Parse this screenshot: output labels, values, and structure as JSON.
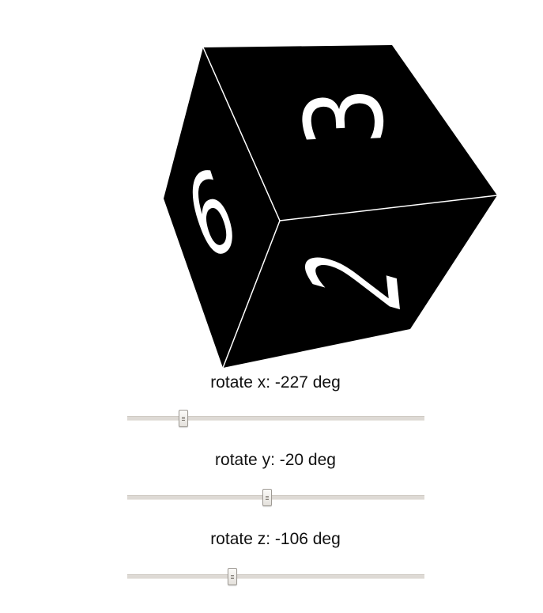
{
  "cube": {
    "faces": [
      {
        "name": "top",
        "digit": "3",
        "color": "#000000"
      },
      {
        "name": "left",
        "digit": "6",
        "color": "#000000"
      },
      {
        "name": "front",
        "digit": "2",
        "color": "#000000"
      }
    ],
    "digit_color": "#ffffff",
    "edge_color": "#ffffff"
  },
  "controls": [
    {
      "axis": "x",
      "label": "rotate x: -227 deg",
      "value": -227,
      "fraction": 0.19
    },
    {
      "axis": "y",
      "label": "rotate y: -20 deg",
      "value": -20,
      "fraction": 0.47
    },
    {
      "axis": "z",
      "label": "rotate z: -106 deg",
      "value": -106,
      "fraction": 0.355
    }
  ]
}
